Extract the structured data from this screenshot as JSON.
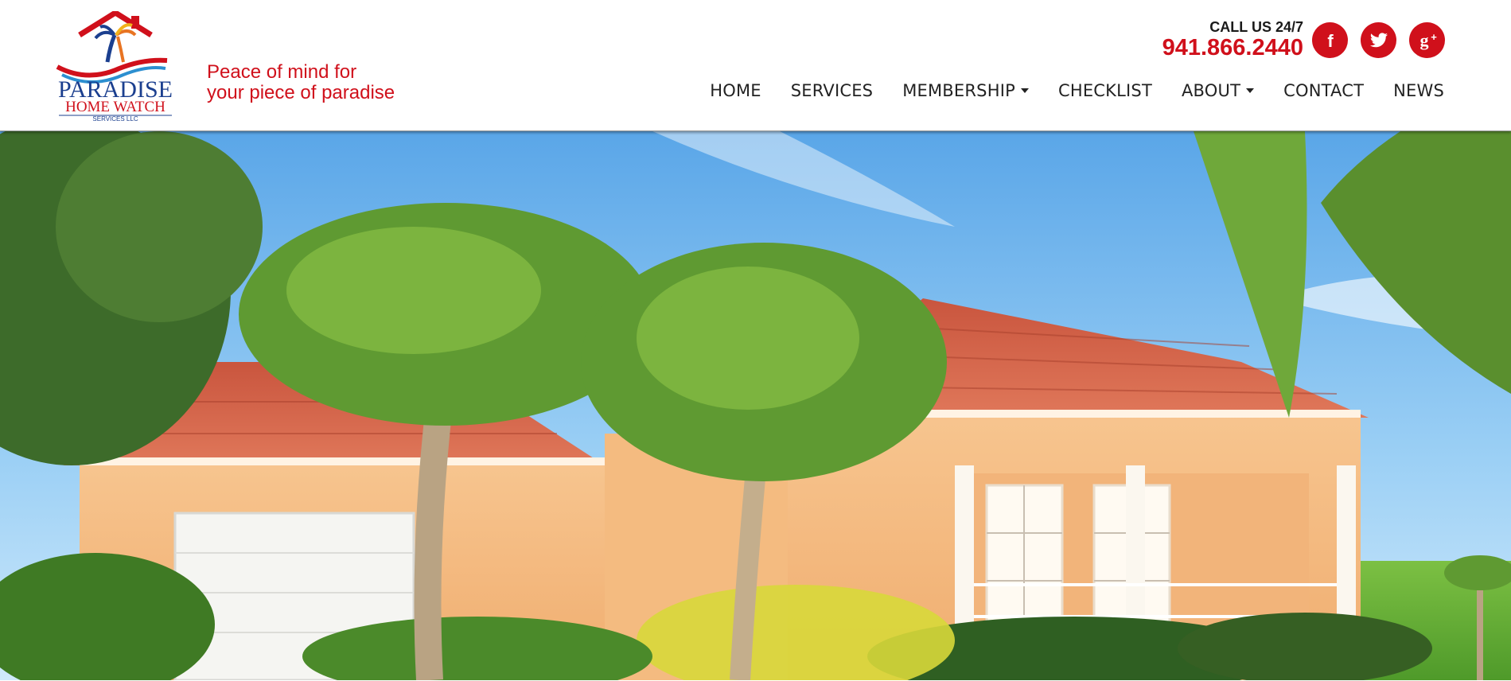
{
  "brand": {
    "logo_line1": "PARADISE",
    "logo_line2": "HOME WATCH",
    "logo_line3": "SERVICES LLC",
    "tagline_line1": "Peace of mind for",
    "tagline_line2": "your piece of paradise",
    "accent_color": "#d0101b",
    "logo_blue": "#1b3f8f"
  },
  "contact": {
    "call_label": "CALL US 24/7",
    "phone": "941.866.2440"
  },
  "social": [
    {
      "name": "facebook-icon",
      "glyph": "f"
    },
    {
      "name": "twitter-icon",
      "glyph": "bird"
    },
    {
      "name": "google-plus-icon",
      "glyph": "g+"
    }
  ],
  "nav": {
    "items": [
      {
        "label": "HOME",
        "dropdown": false
      },
      {
        "label": "SERVICES",
        "dropdown": false
      },
      {
        "label": "MEMBERSHIP",
        "dropdown": true
      },
      {
        "label": "CHECKLIST",
        "dropdown": false
      },
      {
        "label": "ABOUT",
        "dropdown": true
      },
      {
        "label": "CONTACT",
        "dropdown": false
      },
      {
        "label": "NEWS",
        "dropdown": false
      }
    ]
  },
  "hero": {
    "subject": "house-with-palm-trees"
  }
}
